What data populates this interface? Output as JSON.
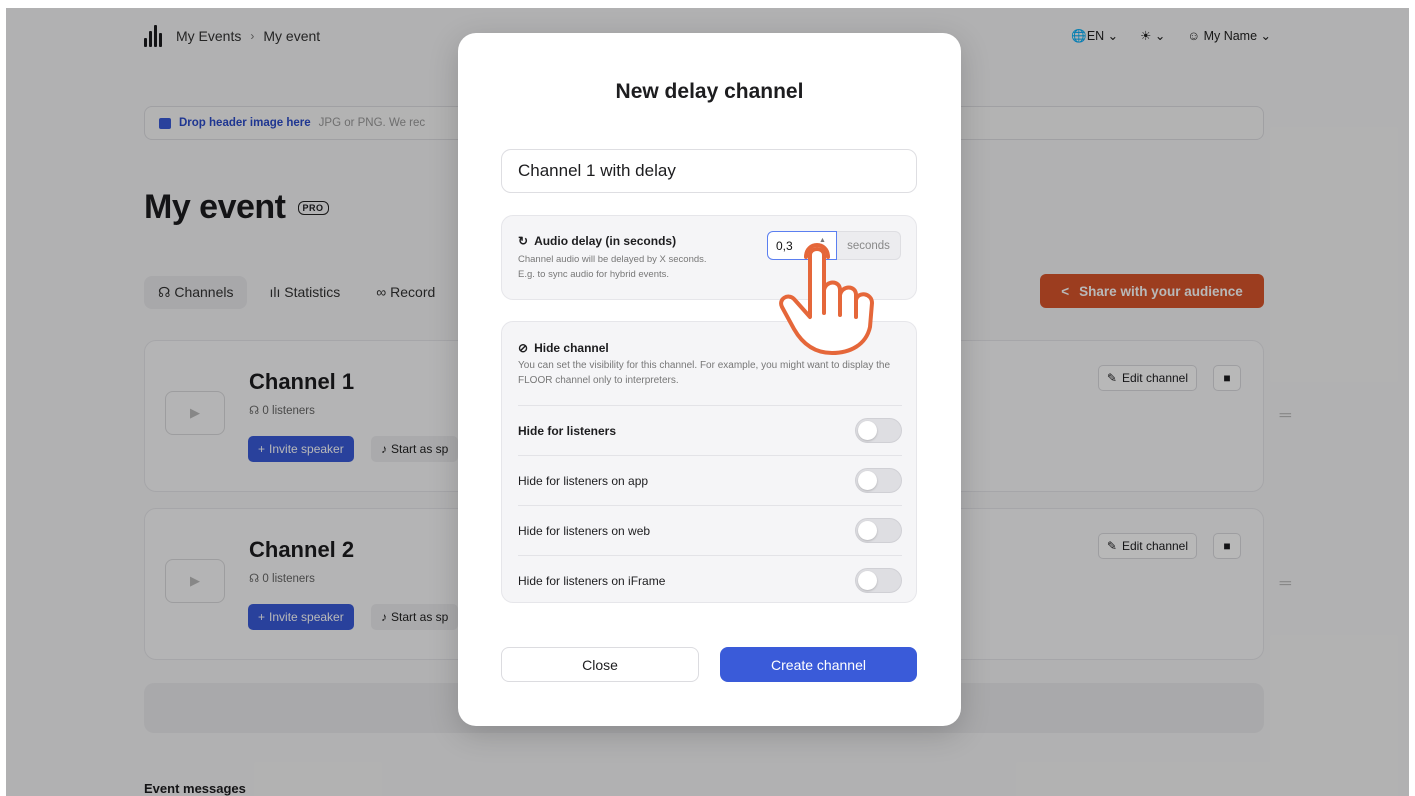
{
  "nav": {
    "breadcrumb": [
      "My Events",
      "My event"
    ],
    "separator": "›",
    "language": "EN",
    "user_name": "My Name"
  },
  "dropzone": {
    "link": "Drop header image here",
    "hint": "JPG or PNG. We rec"
  },
  "event": {
    "title": "My event",
    "badge": "PRO"
  },
  "tabs": [
    {
      "label": "Channels",
      "active": true
    },
    {
      "label": "Statistics",
      "active": false
    },
    {
      "label": "Record",
      "active": false
    }
  ],
  "share_button": "Share with your audience",
  "channels": [
    {
      "name": "Channel 1",
      "listeners": "0 listeners",
      "invite": "Invite speaker",
      "start": "Start as sp",
      "edit": "Edit channel"
    },
    {
      "name": "Channel 2",
      "listeners": "0 listeners",
      "invite": "Invite speaker",
      "start": "Start as sp",
      "edit": "Edit channel"
    }
  ],
  "messages_heading": "Event messages",
  "modal": {
    "title": "New delay channel",
    "channel_name_value": "Channel 1 with delay",
    "delay": {
      "label": "Audio delay (in seconds)",
      "desc_line1": "Channel audio will be delayed by X seconds.",
      "desc_line2": "E.g. to sync audio for hybrid events.",
      "value": "0,3",
      "unit": "seconds"
    },
    "hide": {
      "label": "Hide channel",
      "desc": "You can set the visibility for this channel. For example, you might want to display the FLOOR channel only to interpreters.",
      "rows": [
        {
          "label": "Hide for listeners",
          "on": false
        },
        {
          "label": "Hide for listeners on app",
          "on": false
        },
        {
          "label": "Hide for listeners on web",
          "on": false
        },
        {
          "label": "Hide for listeners on iFrame",
          "on": false
        }
      ]
    },
    "close_label": "Close",
    "create_label": "Create channel"
  },
  "colors": {
    "primary": "#3a5bd9",
    "share": "#d9552b",
    "pointer": "#e5673a"
  }
}
